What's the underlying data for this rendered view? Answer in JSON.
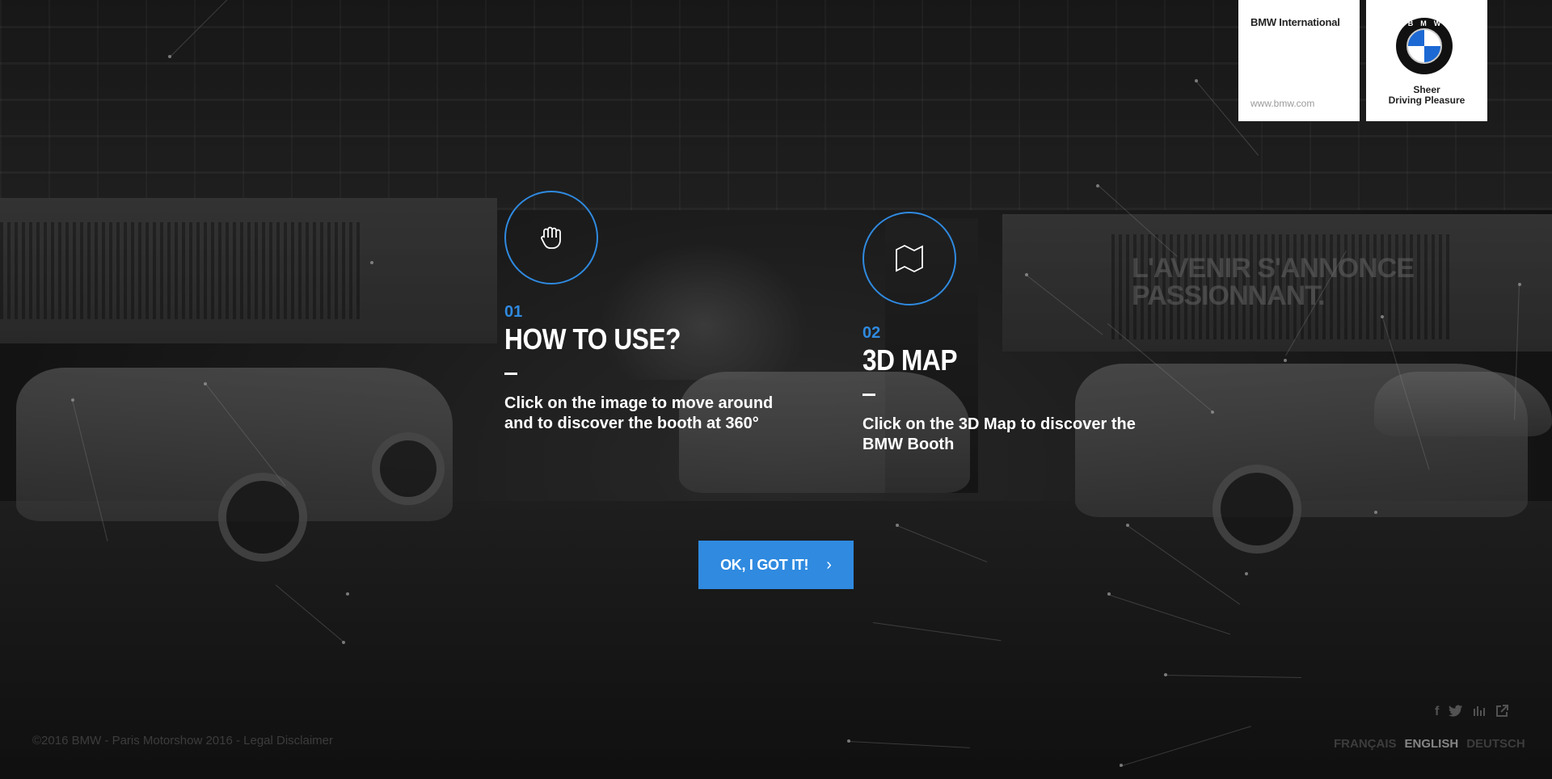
{
  "header": {
    "intl_title": "BMW International",
    "intl_url": "www.bmw.com",
    "logo_letters": "BMW",
    "slogan_line1": "Sheer",
    "slogan_line2": "Driving Pleasure"
  },
  "background": {
    "wall_text_line1": "L'AVENIR S'ANNONCE",
    "wall_text_line2": "PASSIONNANT."
  },
  "features": [
    {
      "number": "01",
      "title": "HOW TO USE?",
      "description": "Click on the image to move around and to discover the booth at 360°",
      "icon": "hand-grab-icon"
    },
    {
      "number": "02",
      "title": "3D MAP",
      "description": "Click on the 3D Map to discover the BMW Booth",
      "icon": "map-icon"
    }
  ],
  "cta": {
    "label": "OK, I GOT IT!",
    "icon": "chevron-right-icon"
  },
  "footer": {
    "legal": "©2016 BMW - Paris Motorshow 2016 - Legal Disclaimer",
    "social_icons": [
      "facebook-icon",
      "twitter-icon",
      "stats-icon",
      "share-icon"
    ],
    "languages": [
      "FRANÇAIS",
      "ENGLISH",
      "DEUTSCH"
    ],
    "active_language": "ENGLISH"
  },
  "colors": {
    "accent": "#2f8ae0",
    "background": "#1a1a1a"
  }
}
